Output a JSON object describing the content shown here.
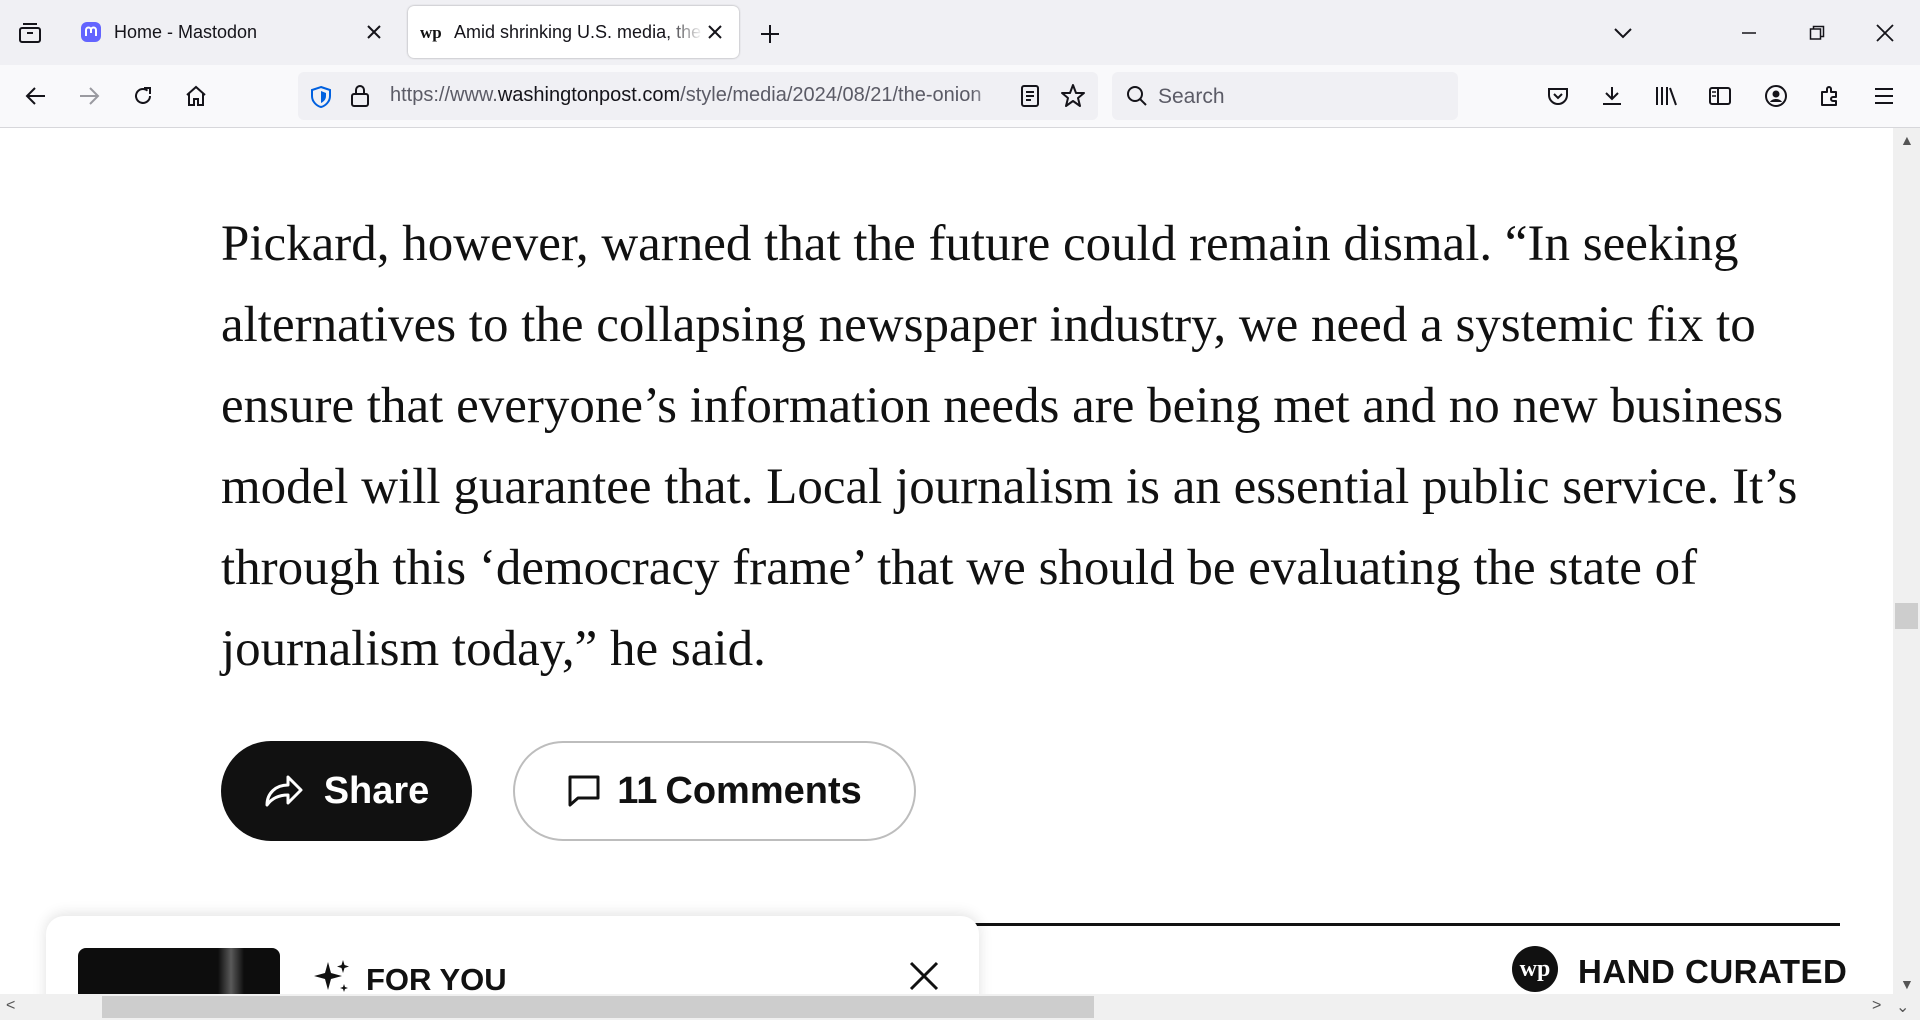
{
  "browser": {
    "tabs": [
      {
        "title": "Home - Mastodon",
        "favicon": "mastodon-icon",
        "active": false
      },
      {
        "title": "Amid shrinking U.S. media, the",
        "favicon": "washington-post-icon",
        "active": true
      }
    ],
    "url": {
      "prefix": "https://www.",
      "host": "washingtonpost.com",
      "path": "/style/media/2024/08/21/the-onion"
    },
    "search_placeholder": "Search"
  },
  "article": {
    "paragraph": "Pickard, however, warned that the future could remain dismal. “In seeking alternatives to the collapsing newspaper industry, we need a systemic fix to ensure that everyone’s information needs are being met and no new business model will guarantee that. Local journalism is an essential public service. It’s through this ‘democracy frame’ that we should be evaluating the state of journalism today,” he said.",
    "share_label": "Share",
    "comments_count": "11",
    "comments_label": "Comments"
  },
  "for_you": {
    "title": "FOR YOU",
    "logo_text": "wp"
  },
  "hand_curated": {
    "label": "HAND CURATED"
  },
  "colors": {
    "tabstrip_bg": "#f0f0f4",
    "navbar_bg": "#f9f9fb",
    "share_bg": "#111111",
    "mastodon_purple": "#6364ff"
  }
}
